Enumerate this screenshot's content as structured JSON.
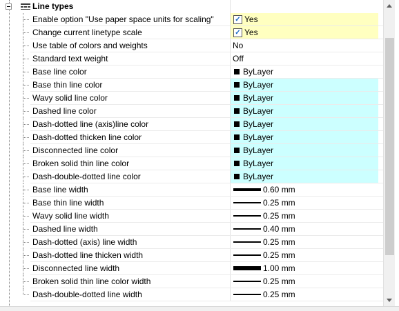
{
  "category": {
    "label": "Line types"
  },
  "rows": [
    {
      "label": "Enable option \"Use paper space units for scaling\"",
      "kind": "check",
      "value": "Yes",
      "bg": "yellow"
    },
    {
      "label": "Change current linetype scale",
      "kind": "check",
      "value": "Yes",
      "bg": "yellow"
    },
    {
      "label": "Use table of colors and weights",
      "kind": "text",
      "value": "No",
      "bg": "none"
    },
    {
      "label": "Standard text weight",
      "kind": "text",
      "value": "Off",
      "bg": "none"
    },
    {
      "label": "Base line color",
      "kind": "color",
      "value": "ByLayer",
      "bg": "none"
    },
    {
      "label": "Base thin line color",
      "kind": "color",
      "value": "ByLayer",
      "bg": "cyan"
    },
    {
      "label": "Wavy solid line color",
      "kind": "color",
      "value": "ByLayer",
      "bg": "cyan"
    },
    {
      "label": "Dashed line color",
      "kind": "color",
      "value": "ByLayer",
      "bg": "cyan"
    },
    {
      "label": "Dash-dotted line (axis)line color",
      "kind": "color",
      "value": "ByLayer",
      "bg": "cyan"
    },
    {
      "label": "Dash-dotted thicken line color",
      "kind": "color",
      "value": "ByLayer",
      "bg": "cyan"
    },
    {
      "label": "Disconnected line color",
      "kind": "color",
      "value": "ByLayer",
      "bg": "cyan"
    },
    {
      "label": "Broken solid thin line color",
      "kind": "color",
      "value": "ByLayer",
      "bg": "cyan"
    },
    {
      "label": "Dash-double-dotted line color",
      "kind": "color",
      "value": "ByLayer",
      "bg": "cyan"
    },
    {
      "label": "Base line width",
      "kind": "width",
      "value": "0.60 mm",
      "bg": "none",
      "mm": 0.6
    },
    {
      "label": "Base thin line width",
      "kind": "width",
      "value": "0.25 mm",
      "bg": "none",
      "mm": 0.25
    },
    {
      "label": "Wavy solid line width",
      "kind": "width",
      "value": "0.25 mm",
      "bg": "none",
      "mm": 0.25
    },
    {
      "label": "Dashed line width",
      "kind": "width",
      "value": "0.40 mm",
      "bg": "none",
      "mm": 0.4
    },
    {
      "label": "Dash-dotted (axis) line width",
      "kind": "width",
      "value": "0.25 mm",
      "bg": "none",
      "mm": 0.25
    },
    {
      "label": "Dash-dotted line thicken width",
      "kind": "width",
      "value": "0.25 mm",
      "bg": "none",
      "mm": 0.25
    },
    {
      "label": "Disconnected line width",
      "kind": "width",
      "value": "1.00 mm",
      "bg": "none",
      "mm": 1.0
    },
    {
      "label": "Broken solid thin line color width",
      "kind": "width",
      "value": "0.25 mm",
      "bg": "none",
      "mm": 0.25
    },
    {
      "label": "Dash-double-dotted line width",
      "kind": "width",
      "value": "0.25 mm",
      "bg": "none",
      "mm": 0.25
    }
  ],
  "colors": {
    "yellow": "#ffffc0",
    "cyan": "#ccffff",
    "check": "#1a6ac4"
  },
  "icons": {
    "expander": "minus-box-icon",
    "category": "line-types-icon",
    "check": "checkmark-icon",
    "swatch": "color-swatch-icon"
  }
}
